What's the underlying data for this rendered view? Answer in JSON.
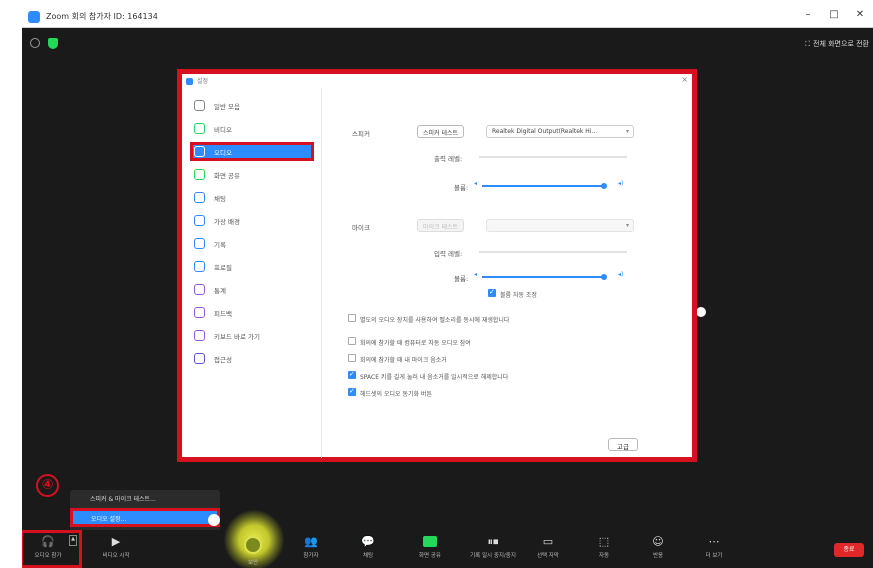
{
  "window": {
    "title": "Zoom 회의 참가자 ID: 164134",
    "controls": [
      "–",
      "□",
      "✕"
    ]
  },
  "meeting_top": {
    "fullscreen_label": "전체 화면으로 전환"
  },
  "dialog": {
    "title": "설정",
    "close_glyph": "×",
    "sidebar": {
      "items": [
        {
          "label": "일반 모음",
          "icon": "general-icon",
          "color": "#888888"
        },
        {
          "label": "비디오",
          "icon": "video-icon",
          "color": "#23d959"
        },
        {
          "label": "오디오",
          "icon": "headphones-icon",
          "color": "#ffffff",
          "active": true
        },
        {
          "label": "화면 공유",
          "icon": "share-screen-icon",
          "color": "#23d959"
        },
        {
          "label": "채팅",
          "icon": "chat-icon",
          "color": "#2d8cff"
        },
        {
          "label": "가상 배경",
          "icon": "background-icon",
          "color": "#2d8cff"
        },
        {
          "label": "기록",
          "icon": "record-icon",
          "color": "#2d8cff"
        },
        {
          "label": "프로필",
          "icon": "profile-icon",
          "color": "#2d8cff"
        },
        {
          "label": "통계",
          "icon": "statistics-icon",
          "color": "#9b59d6"
        },
        {
          "label": "피드백",
          "icon": "feedback-icon",
          "color": "#9b59d6"
        },
        {
          "label": "키보드 바로 가기",
          "icon": "keyboard-icon",
          "color": "#9b59d6"
        },
        {
          "label": "접근성",
          "icon": "accessibility-icon",
          "color": "#5b4fd6"
        }
      ]
    },
    "speaker": {
      "label": "스피커",
      "test_button": "스피커 테스트",
      "device": "Realtek Digital Output(Realtek Hi...",
      "output_level_label": "출력 레벨:",
      "volume_label": "볼륨:",
      "volume_level": 0.95
    },
    "microphone": {
      "label": "마이크",
      "test_button": "마이크 테스트",
      "device": "",
      "input_level_label": "입력 레벨:",
      "volume_label": "볼륨:",
      "volume_level": 0.95,
      "auto_adjust_label": "볼륨 자동 조정",
      "auto_adjust_checked": true
    },
    "options": [
      {
        "label": "별도의 오디오 장치를 사용하여 벨소리를 동시에 재생합니다",
        "checked": false
      },
      {
        "label": "회의에 참가할 때 컴퓨터로 자동 오디오 참여",
        "checked": false
      },
      {
        "label": "회의에 참가할 때 내 마이크 음소거",
        "checked": false
      },
      {
        "label": "SPACE 키를 길게 눌러 내 음소거를 일시적으로 해제합니다",
        "checked": true
      },
      {
        "label": "헤드셋의 오디오 동기화 버튼",
        "checked": true
      }
    ],
    "close_button": "고급"
  },
  "audio_menu": {
    "item_1": "스피커 & 마이크 테스트...",
    "item_2": "오디오 설정..."
  },
  "step_number": "④",
  "toolbar": {
    "items": [
      {
        "label": "오디오 참가",
        "icon": "headphones-icon"
      },
      {
        "label": "비디오 시작",
        "icon": "video-off-icon"
      },
      {
        "label": "보안",
        "icon": "security-icon"
      },
      {
        "label": "참가자",
        "icon": "participants-icon"
      },
      {
        "label": "채팅",
        "icon": "chat-icon"
      },
      {
        "label": "화면 공유",
        "icon": "share-screen-icon"
      },
      {
        "label": "기록 일시 중지/중지",
        "icon": "record-pause-icon"
      },
      {
        "label": "선택 자막",
        "icon": "captions-icon"
      },
      {
        "label": "자동",
        "icon": "apps-icon"
      },
      {
        "label": "반응",
        "icon": "reactions-icon"
      },
      {
        "label": "더 보기",
        "icon": "more-icon"
      }
    ],
    "end_button": "종료"
  }
}
